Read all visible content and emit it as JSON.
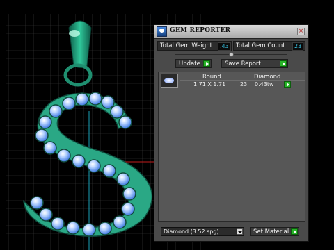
{
  "window": {
    "title": "GEM REPORTER",
    "close_icon": "close-icon"
  },
  "stats": {
    "total_weight_label": "Total Gem Weight",
    "total_weight_value": ".43",
    "total_count_label": "Total Gem Count",
    "total_count_value": "23"
  },
  "actions": {
    "update_label": "Update",
    "save_label": "Save Report"
  },
  "table": {
    "columns": [
      "Round",
      "Diamond"
    ],
    "rows": [
      {
        "size": "1.71 X 1.71",
        "count": "23",
        "weight": "0.43tw"
      }
    ]
  },
  "material": {
    "selected": "Diamond    (3.52 spg)",
    "set_label": "Set Material"
  },
  "colors": {
    "viewport_bg": "#000000",
    "grid": "#3c3c3c",
    "metal": "#2aa885",
    "gem_accent": "#4aa0ff",
    "axis_cyan": "#1aa2b8",
    "axis_red": "#c21c1c",
    "panel_bg": "#4a4a4a"
  }
}
